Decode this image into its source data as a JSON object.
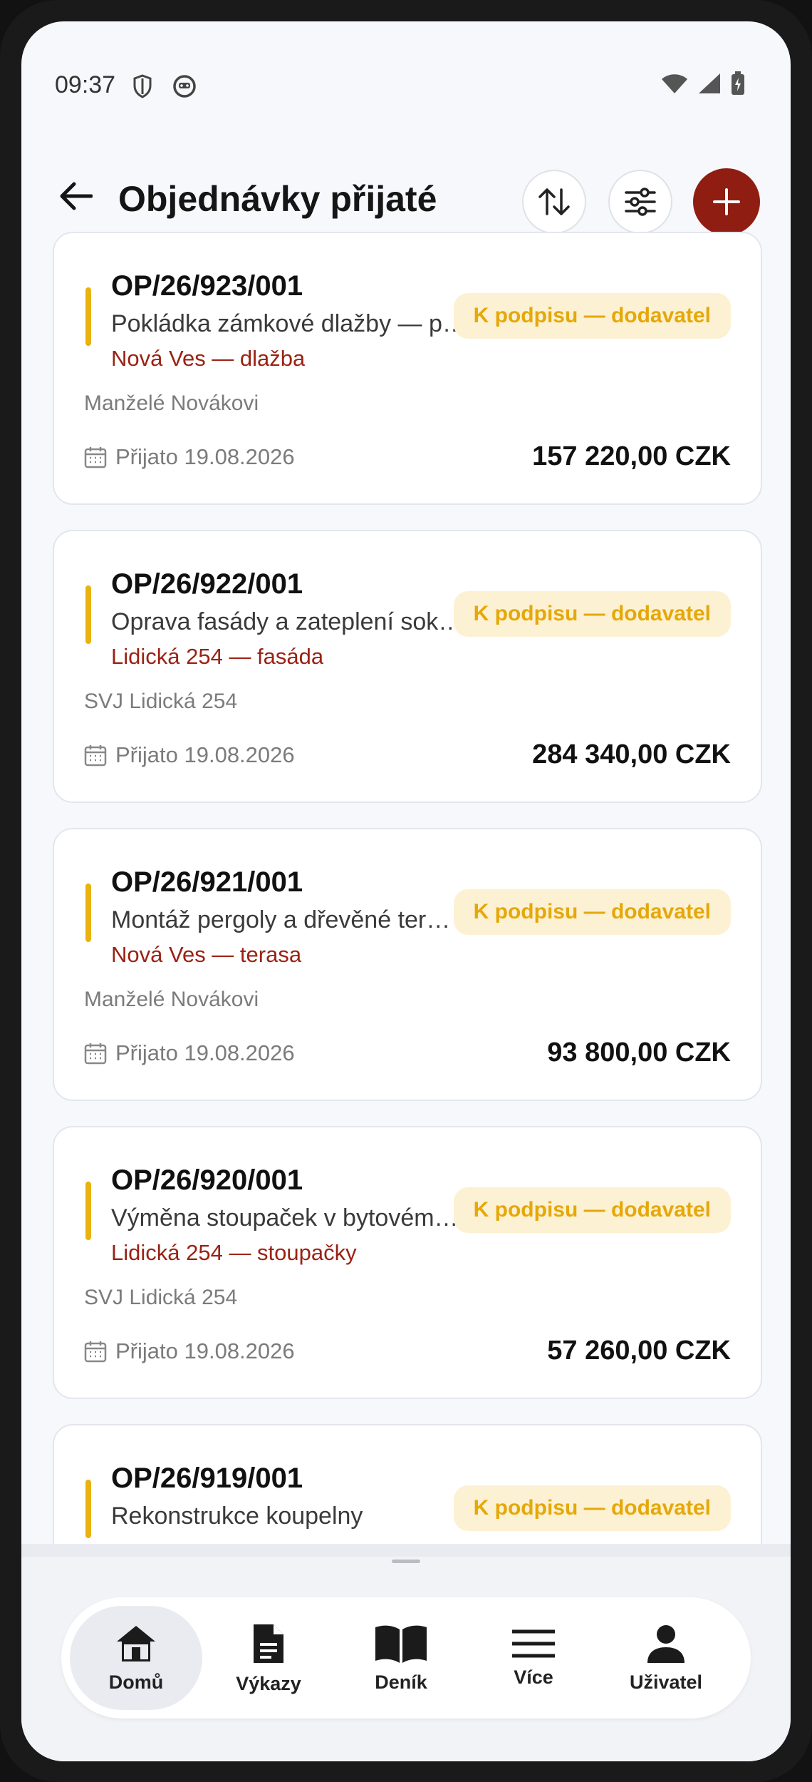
{
  "status_bar": {
    "time": "09:37"
  },
  "header": {
    "title": "Objednávky přijaté"
  },
  "orders": [
    {
      "code": "OP/26/923/001",
      "description": "Pokládka zámkové dlažby — p…",
      "site": "Nová Ves — dlažba",
      "status": "K podpisu — dodavatel",
      "client": "Manželé Novákovi",
      "received": "Přijato 19.08.2026",
      "amount": "157 220,00 CZK"
    },
    {
      "code": "OP/26/922/001",
      "description": "Oprava fasády a zateplení sok…",
      "site": "Lidická 254 — fasáda",
      "status": "K podpisu — dodavatel",
      "client": "SVJ Lidická 254",
      "received": "Přijato 19.08.2026",
      "amount": "284 340,00 CZK"
    },
    {
      "code": "OP/26/921/001",
      "description": "Montáž pergoly a dřevěné ter…",
      "site": "Nová Ves — terasa",
      "status": "K podpisu — dodavatel",
      "client": "Manželé Novákovi",
      "received": "Přijato 19.08.2026",
      "amount": "93 800,00 CZK"
    },
    {
      "code": "OP/26/920/001",
      "description": "Výměna stoupaček v bytovém…",
      "site": "Lidická 254 — stoupačky",
      "status": "K podpisu — dodavatel",
      "client": "SVJ Lidická 254",
      "received": "Přijato 19.08.2026",
      "amount": "57 260,00 CZK"
    },
    {
      "code": "OP/26/919/001",
      "description": "Rekonstrukce koupelny",
      "site": "",
      "status": "K podpisu — dodavatel",
      "client": "",
      "received": "",
      "amount": ""
    }
  ],
  "nav": {
    "items": [
      {
        "label": "Domů",
        "icon": "home-icon"
      },
      {
        "label": "Výkazy",
        "icon": "document-icon"
      },
      {
        "label": "Deník",
        "icon": "book-icon"
      },
      {
        "label": "Více",
        "icon": "menu-icon"
      },
      {
        "label": "Uživatel",
        "icon": "user-icon"
      }
    ]
  },
  "colors": {
    "accent": "#8f1d12",
    "status_bg": "#fdf1d3",
    "status_text": "#e5a80a",
    "site_text": "#9a2214"
  }
}
